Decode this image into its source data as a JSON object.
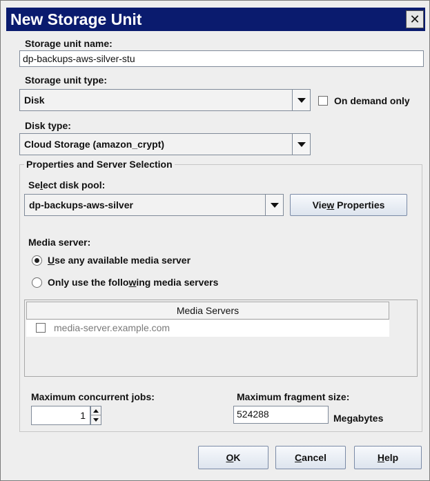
{
  "window": {
    "title": "New Storage Unit",
    "close_glyph": "✕"
  },
  "storage_unit_name": {
    "label": "Storage unit name:",
    "value": "dp-backups-aws-silver-stu"
  },
  "storage_unit_type": {
    "label": "Storage unit type:",
    "selected": "Disk",
    "on_demand_label": "On demand only",
    "on_demand_checked": false
  },
  "disk_type": {
    "label": "Disk type:",
    "selected": "Cloud Storage (amazon_crypt)"
  },
  "properties_group": {
    "title": "Properties and Server Selection",
    "disk_pool": {
      "label_pre": "Se",
      "label_mnemonic": "l",
      "label_post": "ect disk pool:",
      "selected": "dp-backups-aws-silver"
    },
    "view_properties": {
      "pre": "Vie",
      "mnemonic": "w",
      "post": " Properties"
    },
    "media_server": {
      "label": "Media server:",
      "option_any_mnemonic": "U",
      "option_any_post": "se any available media server",
      "option_any_selected": true,
      "option_following_pre": "Only use the follo",
      "option_following_mnemonic": "w",
      "option_following_post": "ing media servers",
      "option_following_selected": false
    },
    "table": {
      "header": "Media Servers",
      "rows": [
        {
          "name": "media-server.example.com",
          "checked": false
        }
      ]
    },
    "max_concurrent_jobs": {
      "label": "Maximum concurrent jobs:",
      "value": "1"
    },
    "max_fragment_size": {
      "label": "Maximum fragment size:",
      "value": "524288",
      "unit": "Megabytes"
    }
  },
  "buttons": {
    "ok": {
      "mnemonic": "O",
      "post": "K"
    },
    "cancel": {
      "mnemonic": "C",
      "post": "ancel"
    },
    "help": {
      "mnemonic": "H",
      "post": "elp"
    }
  },
  "colors": {
    "titlebar": "#0a1b6e",
    "window_bg": "#eeeeee"
  }
}
